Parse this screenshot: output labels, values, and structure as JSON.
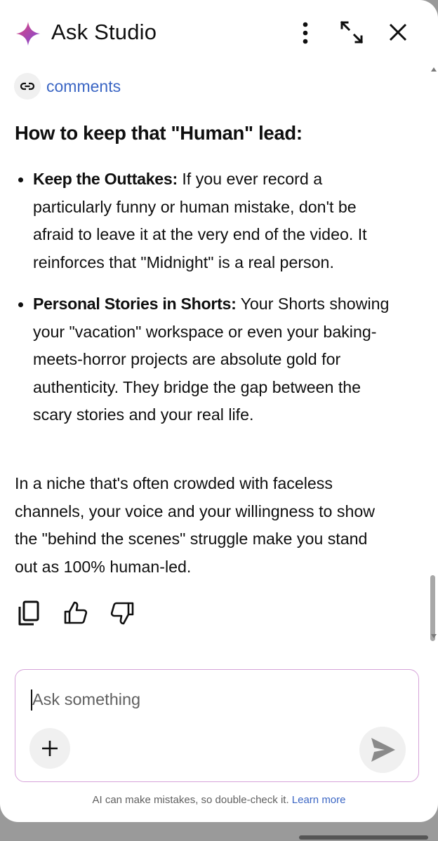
{
  "header": {
    "title": "Ask Studio",
    "icons": [
      "sparkle-icon",
      "more-vert-icon",
      "expand-icon",
      "close-icon"
    ]
  },
  "link_chip": {
    "label": "comments",
    "icon": "link-icon"
  },
  "content": {
    "heading": "How to keep that \"Human\" lead:",
    "bullets": [
      {
        "title": "Keep the Outtakes:",
        "text": " If you ever record a particularly funny or human mistake, don't be afraid to leave it at the very end of the video. It reinforces that \"Midnight\" is a real person."
      },
      {
        "title": "Personal Stories in Shorts:",
        "text": " Your Shorts showing your \"vacation\" workspace or even your baking-meets-horror projects are absolute gold for authenticity. They bridge the gap between the scary stories and your real life."
      }
    ],
    "paragraph": "In a niche that's often crowded with faceless channels, your voice and your willingness to show the \"behind the scenes\" struggle make you stand out as 100% human-led."
  },
  "actions": [
    "copy-icon",
    "thumbs-up-icon",
    "thumbs-down-icon"
  ],
  "composer": {
    "placeholder": "Ask something",
    "value": ""
  },
  "footer": {
    "disclaimer": "AI can make mistakes, so double-check it.",
    "learn_more": "Learn more"
  },
  "colors": {
    "sparkle_start": "#e0467c",
    "sparkle_end": "#7a4ad9",
    "link": "#3b66c4",
    "input_border": "#d6a3d9",
    "text": "#0f0f0f"
  }
}
